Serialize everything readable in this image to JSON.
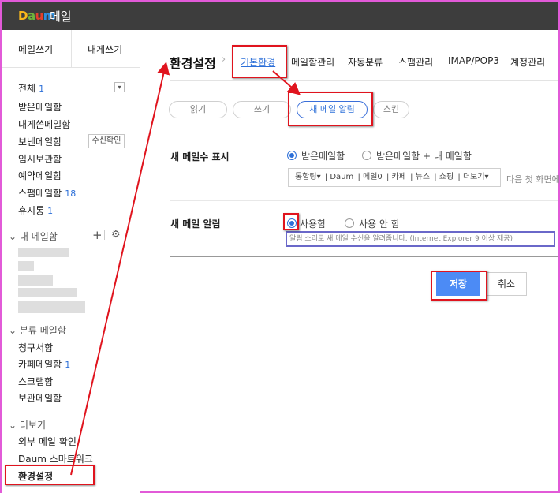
{
  "app": {
    "logo": {
      "d1": "D",
      "d2": "a",
      "d3": "u",
      "d4": "m"
    },
    "title": "메일"
  },
  "sidebar": {
    "compose": "메일쓰기",
    "to_me": "내게쓰기",
    "all": {
      "label": "전체",
      "count": "1"
    },
    "inbox": "받은메일함",
    "sent": "내게쓴메일함",
    "outbox": "보낸메일함",
    "read_confirm": "수신확인",
    "drafts": "임시보관함",
    "reserved": "예약메일함",
    "spam": {
      "label": "스팸메일함",
      "count": "18"
    },
    "trash": {
      "label": "휴지통",
      "count": "1"
    },
    "my_mailbox": "내 메일함",
    "category": "분류 메일함",
    "bills": {
      "label": "청구서함"
    },
    "cafe": {
      "label": "카페메일함",
      "count": "1"
    },
    "scrap": "스크랩함",
    "archive": "보관메일함",
    "more": "더보기",
    "external": "외부 메일 확인",
    "smartwork": "Daum 스마트워크",
    "settings": "환경설정"
  },
  "main": {
    "title": "환경설정",
    "tabs": [
      "기본환경",
      "메일함관리",
      "자동분류",
      "스팸관리",
      "IMAP/POP3",
      "계정관리"
    ],
    "subtabs": [
      "읽기",
      "쓰기",
      "새 메일 알림",
      "스킨"
    ],
    "newcount": {
      "label": "새 메일수 표시",
      "opt1": "받은메일함",
      "opt2": "받은메일함 + 내 메일함",
      "services": [
        "통합팅▾",
        "Daum",
        "메일0",
        "카페",
        "뉴스",
        "쇼핑",
        "더보기▾"
      ],
      "next": "다음 첫 화면에"
    },
    "alert": {
      "label": "새 메일 알림",
      "opt_on": "사용함",
      "opt_off": "사용 안 함",
      "hint": "알림 소리로 새 메일 수신을 알려줍니다. (Internet Explorer 9 이상 제공)"
    },
    "save": "저장",
    "cancel": "취소"
  },
  "colors": {
    "accent": "#2c6fd8",
    "highlight": "#e0141e",
    "save": "#4c8bf5"
  }
}
